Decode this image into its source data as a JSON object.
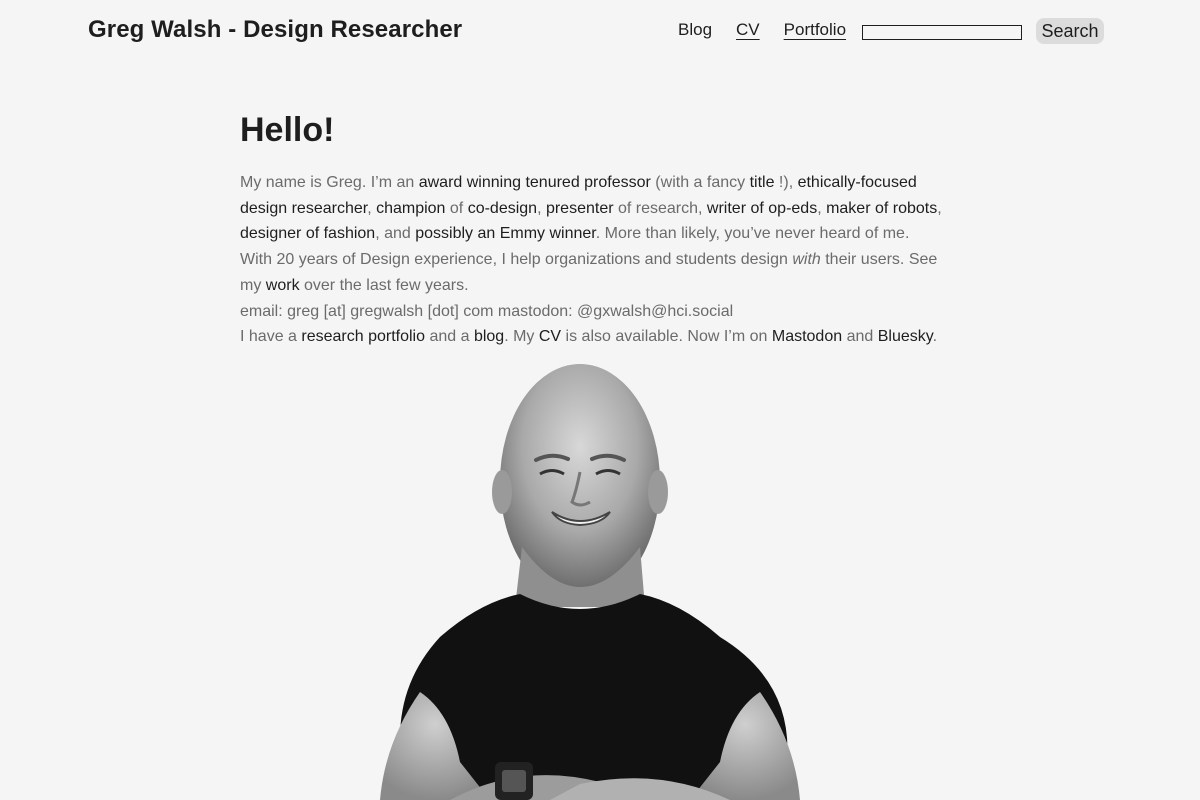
{
  "header": {
    "site_title": "Greg Walsh - Design Researcher",
    "nav": {
      "blog": "Blog",
      "cv": "CV",
      "portfolio": "Portfolio"
    },
    "search": {
      "value": "",
      "button_label": "Search"
    }
  },
  "main": {
    "heading": "Hello!",
    "p1": {
      "t1": "My name is Greg. I’m an ",
      "l1": "award winning tenured professor",
      "t2": " (with a fancy ",
      "l2": "title",
      "t3": " !), ",
      "l3": "ethically-focused design researcher",
      "t4": ", ",
      "l4": "champion",
      "t5": " of ",
      "l5": "co-design",
      "t6": ", ",
      "l6": "presenter",
      "t7": " of research, ",
      "l7": "writer of op-eds",
      "t8": ", ",
      "l8": "maker of robots",
      "t9": ", ",
      "l9": "designer of fashion",
      "t10": ", and ",
      "l10": "possibly an Emmy winner",
      "t11": ". More than likely, you’ve never heard of me."
    },
    "p2": {
      "t1": "With 20 years of Design experience, I help organizations and students design ",
      "em": "with",
      "t2": " their users. See my ",
      "l1": "work",
      "t3": " over the last few years."
    },
    "p3": "email: greg [at] gregwalsh [dot] com mastodon: @gxwalsh@hci.social",
    "p4": {
      "t1": "I have a ",
      "l1": "research portfolio",
      "t2": " and a ",
      "l2": "blog",
      "t3": ". My ",
      "l3": "CV",
      "t4": " is also available. Now I’m on ",
      "l4": "Mastodon",
      "t5": " and ",
      "l5": "Bluesky",
      "t6": "."
    }
  },
  "colors": {
    "background": "#f5f5f5",
    "text": "#1e1e1e",
    "muted_text": "#6b6b6b",
    "button_bg": "#dcdcdc"
  },
  "image": {
    "portrait": "black-and-white portrait photo"
  }
}
